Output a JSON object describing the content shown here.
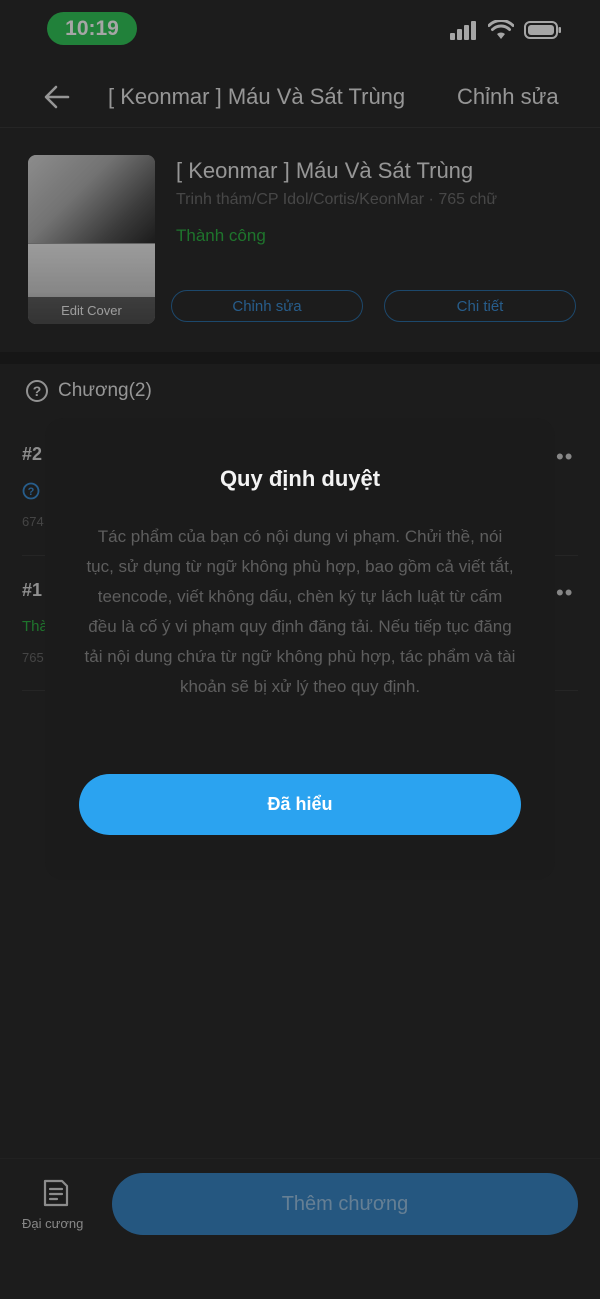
{
  "status_bar": {
    "time": "10:19"
  },
  "header": {
    "title": "[ Keonmar ] Máu Và Sát Trùng",
    "edit_label": "Chỉnh sửa"
  },
  "book": {
    "title": "[ Keonmar ] Máu Và Sát Trùng",
    "meta": "Trinh thám/CP Idol/Cortis/KeonMar · 765 chữ",
    "status": "Thành công",
    "cover_label": "Edit Cover",
    "edit_button": "Chỉnh sửa",
    "detail_button": "Chi tiết"
  },
  "chapters": {
    "header": "Chương(2)",
    "items": [
      {
        "num": "#2",
        "count_partial": "674"
      },
      {
        "num": "#1",
        "status_partial": "Thà",
        "count_partial": "765"
      }
    ]
  },
  "modal": {
    "title": "Quy định duyệt",
    "body": "Tác phẩm của bạn có nội dung vi phạm. Chửi thề, nói tục, sử dụng từ ngữ không phù hợp, bao gồm cả viết tắt, teencode, viết không dấu, chèn ký tự lách luật từ cấm đều là cố ý vi phạm quy định đăng tải. Nếu tiếp tục đăng tải nội dung chứa từ ngữ không phù hợp, tác phẩm và tài khoản sẽ bị xử lý theo quy định.",
    "button": "Đã hiểu"
  },
  "bottom": {
    "outline_label": "Đại cương",
    "add_button": "Thêm chương"
  },
  "colors": {
    "accent": "#2ba3f0",
    "success": "#2fb344",
    "time_pill": "#34c759"
  }
}
